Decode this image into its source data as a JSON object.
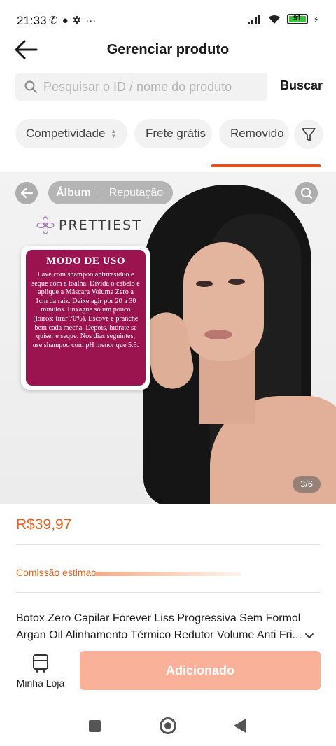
{
  "status_bar": {
    "time": "21:33",
    "notification_icons": [
      "whatsapp-icon",
      "chat-icon",
      "app-icon",
      "more-dots-icon"
    ],
    "battery_level": "91",
    "battery_color": "#39c13c"
  },
  "header": {
    "title": "Gerenciar produto"
  },
  "search": {
    "placeholder": "Pesquisar o ID / nome do produto",
    "button_label": "Buscar"
  },
  "filters": {
    "chips": [
      "Competividade",
      "Frete grátis",
      "Removido"
    ],
    "active_tab_color": "#e84e1b"
  },
  "gallery": {
    "segment_album": "Álbum",
    "segment_reputation": "Reputação",
    "brand_name": "PRETTIEST",
    "card_title": "MODO DE USO",
    "card_text": "Lave com shampoo antirresíduo e seque com a toalha. Divida o cabelo e aplique a Máscara Volume Zero a 1cm da raiz. Deixe agir por 20 a 30 minutos. Enxágue só um pouco (loiros: tirar 70%). Escove e pranche bem cada mecha. Depois, hidrate se quiser e seque. Nos dias seguintes, use shampoo com pH menor que 5.5.",
    "card_color": "#9b1450",
    "pager": "3/6"
  },
  "product": {
    "price": "R$39,97",
    "commission_label": "Comissão estimac",
    "name_line1": "Botox Zero Capilar Forever Liss Progressiva Sem Formol",
    "name_line2": "Argan Oil Alinhamento Térmico Redutor Volume Anti Fri...",
    "accent_color": "#e8601c"
  },
  "bottom_bar": {
    "store_label": "Minha Loja",
    "add_button_label": "Adicionado",
    "add_button_color": "#f9b19a"
  }
}
